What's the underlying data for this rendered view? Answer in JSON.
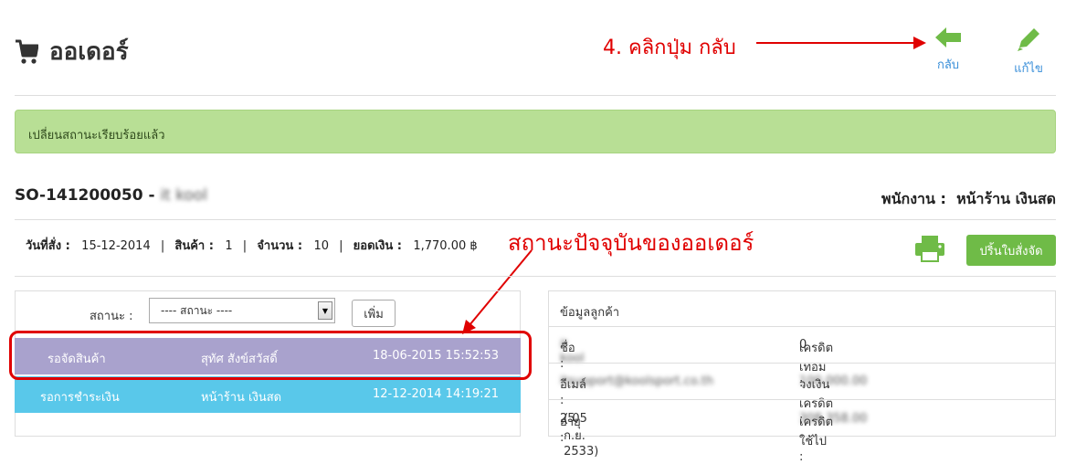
{
  "header": {
    "title": "ออเดอร์",
    "back_label": "กลับ",
    "edit_label": "แก้ไข"
  },
  "annotations": {
    "step": "4. คลิกปุ่ม กลับ",
    "status": "สถานะปัจจุบันของออเดอร์"
  },
  "alert": {
    "message": "เปลี่ยนสถานะเรียบร้อยแล้ว"
  },
  "order": {
    "number": "SO-141200050",
    "separator": " - ",
    "customer_blurred": "it kool",
    "staff_label": "พนักงาน :",
    "staff_value": "หน้าร้าน เงินสด"
  },
  "summary": {
    "date_label": "วันที่สั่ง :",
    "date_value": "15-12-2014",
    "products_label": "สินค้า :",
    "products_value": "1",
    "qty_label": "จำนวน :",
    "qty_value": "10",
    "amount_label": "ยอดเงิน :",
    "amount_value": "1,770.00 ฿",
    "print_button": "ปริ้นใบสั่งจัด"
  },
  "status_form": {
    "label": "สถานะ :",
    "select_value": "---- สถานะ ----",
    "add_button": "เพิ่ม"
  },
  "status_history": [
    {
      "status": "รอจัดสินค้า",
      "by": "สุทัศ สังข์สวัสดิ์",
      "datetime": "18-06-2015 15:52:53",
      "color": "#a9a2cd"
    },
    {
      "status": "รอการชำระเงิน",
      "by": "หน้าร้าน เงินสด",
      "datetime": "12-12-2014 14:19:21",
      "color": "#59c8ea"
    }
  ],
  "customer": {
    "heading": "ข้อมูลลูกค้า",
    "name_label": "ชื่อ :",
    "name_value_blurred": "it kool",
    "credit_term_label": "เครดิตเทอม :",
    "credit_term_value": "0",
    "email_label": "อีเมล์ :",
    "email_value_blurred": "itsupport@koolsport.co.th",
    "credit_limit_label": "วงเงินเครดิต :",
    "credit_limit_value_blurred": "100,000.00",
    "age_label": "อายุ :",
    "age_value": "25",
    "birth_date": "( 05 ก.ย. 2533)",
    "credit_used_label": "เครดิตใช้ไป :",
    "credit_used_value_blurred": "308,358.00"
  },
  "colors": {
    "accent_green": "#6fbb47",
    "alert_bg": "#b8df95",
    "annotation_red": "#e00000",
    "link_blue": "#3a8fd9"
  },
  "icons": {
    "title": "shopping-cart-icon",
    "back": "arrow-left-icon",
    "edit": "pencil-icon",
    "print": "printer-icon",
    "select": "chevron-down-icon"
  }
}
